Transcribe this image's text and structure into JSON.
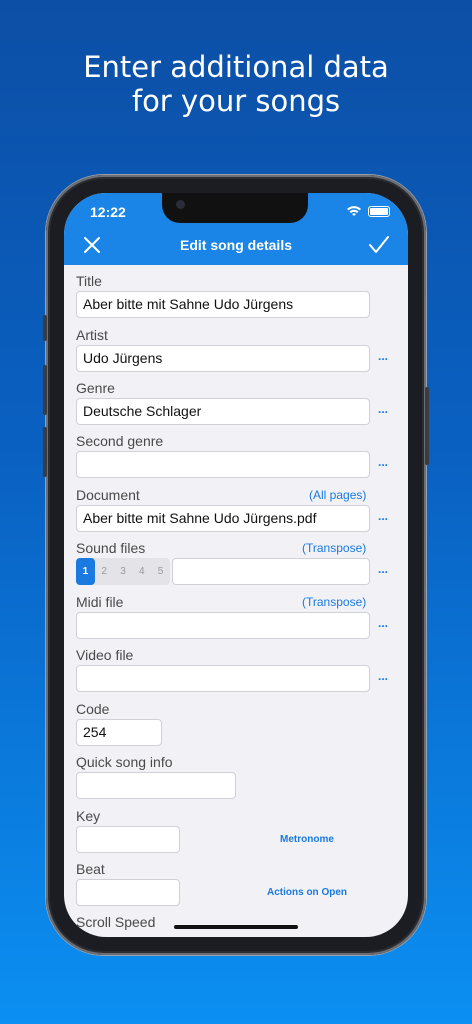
{
  "headline": {
    "line1": "Enter additional data",
    "line2": "for your songs"
  },
  "status": {
    "time": "12:22"
  },
  "nav": {
    "title": "Edit song details"
  },
  "fields": {
    "title": {
      "label": "Title",
      "value": "Aber bitte mit Sahne Udo Jürgens"
    },
    "artist": {
      "label": "Artist",
      "value": "Udo Jürgens"
    },
    "genre": {
      "label": "Genre",
      "value": "Deutsche Schlager"
    },
    "second_genre": {
      "label": "Second genre",
      "value": ""
    },
    "document": {
      "label": "Document",
      "value": "Aber bitte mit Sahne Udo Jürgens.pdf",
      "link": "(All pages)"
    },
    "sound_files": {
      "label": "Sound files",
      "link": "(Transpose)",
      "slots": [
        "1",
        "2",
        "3",
        "4",
        "5"
      ],
      "selected": "1",
      "value": ""
    },
    "midi_file": {
      "label": "Midi file",
      "link": "(Transpose)",
      "value": ""
    },
    "video_file": {
      "label": "Video file",
      "value": ""
    },
    "code": {
      "label": "Code",
      "value": "254"
    },
    "quick_info": {
      "label": "Quick song info",
      "value": ""
    },
    "key": {
      "label": "Key",
      "value": "",
      "action": "Metronome"
    },
    "beat": {
      "label": "Beat",
      "value": "",
      "action": "Actions on Open"
    },
    "scroll_speed": {
      "label": "Scroll Speed"
    }
  },
  "more_label": "...",
  "colors": {
    "accent": "#1a7ae0",
    "navbar": "#1a85e6",
    "background": "#f1f1f6"
  }
}
